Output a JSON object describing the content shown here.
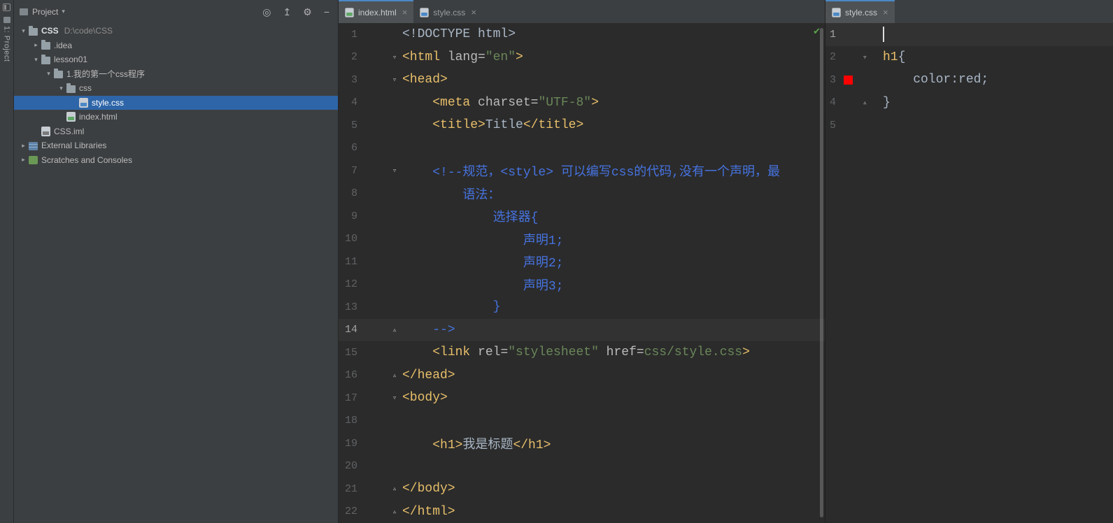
{
  "colors": {
    "selection_blue": "#2E65A8",
    "tab_accent": "#4A88C7",
    "comment_blue": "#4673E0",
    "tag_yellow": "#E8BF6A",
    "string_green": "#6A8759",
    "red_swatch": "#FF0000"
  },
  "tool_strip": {
    "button_label": "1: Project"
  },
  "project_panel": {
    "header": {
      "title": "Project",
      "icons": [
        {
          "name": "locate-file-icon",
          "glyph": "◎"
        },
        {
          "name": "collapse-all-icon",
          "glyph": "↥"
        },
        {
          "name": "settings-gear-icon",
          "glyph": "⚙"
        },
        {
          "name": "hide-panel-icon",
          "glyph": "−"
        }
      ]
    },
    "tree": [
      {
        "indent": 0,
        "chevron": "down",
        "icon": "folder",
        "label": "CSS",
        "bold": true,
        "suffix": "D:\\code\\CSS",
        "selected": false
      },
      {
        "indent": 1,
        "chevron": "right",
        "icon": "folder",
        "label": ".idea",
        "selected": false
      },
      {
        "indent": 1,
        "chevron": "down",
        "icon": "folder",
        "label": "lesson01",
        "selected": false
      },
      {
        "indent": 2,
        "chevron": "down",
        "icon": "folder",
        "label": "1.我的第一个css程序",
        "selected": false
      },
      {
        "indent": 3,
        "chevron": "down",
        "icon": "folder",
        "label": "css",
        "selected": false
      },
      {
        "indent": 4,
        "chevron": "none",
        "icon": "css-file",
        "label": "style.css",
        "selected": true
      },
      {
        "indent": 3,
        "chevron": "none",
        "icon": "html-file",
        "label": "index.html",
        "selected": false
      },
      {
        "indent": 1,
        "chevron": "none",
        "icon": "iml-file",
        "label": "CSS.iml",
        "selected": false
      },
      {
        "indent": 0,
        "chevron": "right",
        "icon": "library",
        "label": "External Libraries",
        "selected": false
      },
      {
        "indent": 0,
        "chevron": "right",
        "icon": "scratches",
        "label": "Scratches and Consoles",
        "selected": false
      }
    ]
  },
  "left_editor": {
    "tabs": [
      {
        "label": "index.html",
        "icon": "html-file",
        "active": true
      },
      {
        "label": "style.css",
        "icon": "css-file",
        "active": false
      }
    ],
    "inspection_glyph": "✔",
    "current_line": 14,
    "lines": [
      {
        "n": 1,
        "fold": "",
        "segs": [
          [
            "<!DOCTYPE html>",
            "plain"
          ]
        ]
      },
      {
        "n": 2,
        "fold": "start",
        "segs": [
          [
            "<html",
            "tag"
          ],
          [
            " lang=",
            "attr"
          ],
          [
            "\"en\"",
            "string"
          ],
          [
            ">",
            "tag"
          ]
        ]
      },
      {
        "n": 3,
        "fold": "start",
        "segs": [
          [
            "<head>",
            "tag"
          ]
        ]
      },
      {
        "n": 4,
        "fold": "",
        "segs": [
          [
            "    ",
            "plain"
          ],
          [
            "<meta",
            "tag"
          ],
          [
            " charset=",
            "attr"
          ],
          [
            "\"UTF-8\"",
            "string"
          ],
          [
            ">",
            "tag"
          ]
        ]
      },
      {
        "n": 5,
        "fold": "",
        "segs": [
          [
            "    ",
            "plain"
          ],
          [
            "<title>",
            "tag"
          ],
          [
            "Title",
            "plain"
          ],
          [
            "</title>",
            "tag"
          ]
        ]
      },
      {
        "n": 6,
        "fold": "",
        "segs": []
      },
      {
        "n": 7,
        "fold": "start",
        "segs": [
          [
            "    ",
            "plain"
          ],
          [
            "<!--规范，<style> 可以编写css的代码,没有一个声明，最",
            "comment"
          ]
        ]
      },
      {
        "n": 8,
        "fold": "",
        "segs": [
          [
            "        语法：",
            "comment"
          ]
        ]
      },
      {
        "n": 9,
        "fold": "",
        "segs": [
          [
            "            选择器{",
            "comment"
          ]
        ]
      },
      {
        "n": 10,
        "fold": "",
        "segs": [
          [
            "                声明1;",
            "comment"
          ]
        ]
      },
      {
        "n": 11,
        "fold": "",
        "segs": [
          [
            "                声明2;",
            "comment"
          ]
        ]
      },
      {
        "n": 12,
        "fold": "",
        "segs": [
          [
            "                声明3;",
            "comment"
          ]
        ]
      },
      {
        "n": 13,
        "fold": "",
        "segs": [
          [
            "            }",
            "comment"
          ]
        ]
      },
      {
        "n": 14,
        "fold": "end",
        "segs": [
          [
            "    -->",
            "comment"
          ]
        ]
      },
      {
        "n": 15,
        "fold": "",
        "segs": [
          [
            "    ",
            "plain"
          ],
          [
            "<link",
            "tag"
          ],
          [
            " rel=",
            "attr"
          ],
          [
            "\"stylesheet\"",
            "string"
          ],
          [
            " href=",
            "attr"
          ],
          [
            "css/style.css",
            "string"
          ],
          [
            ">",
            "tag"
          ]
        ]
      },
      {
        "n": 16,
        "fold": "end",
        "segs": [
          [
            "</head>",
            "tag"
          ]
        ]
      },
      {
        "n": 17,
        "fold": "start",
        "segs": [
          [
            "<body>",
            "tag"
          ]
        ]
      },
      {
        "n": 18,
        "fold": "",
        "segs": []
      },
      {
        "n": 19,
        "fold": "",
        "segs": [
          [
            "    ",
            "plain"
          ],
          [
            "<h1>",
            "tag"
          ],
          [
            "我是标题",
            "plain"
          ],
          [
            "</h1>",
            "tag"
          ]
        ]
      },
      {
        "n": 20,
        "fold": "",
        "segs": []
      },
      {
        "n": 21,
        "fold": "end",
        "segs": [
          [
            "</body>",
            "tag"
          ]
        ]
      },
      {
        "n": 22,
        "fold": "end",
        "segs": [
          [
            "</html>",
            "tag"
          ]
        ]
      }
    ]
  },
  "right_editor": {
    "tabs": [
      {
        "label": "style.css",
        "icon": "css-file",
        "active": true
      }
    ],
    "current_line": 1,
    "lines": [
      {
        "n": 1,
        "fold": "",
        "caret": true,
        "segs": []
      },
      {
        "n": 2,
        "fold": "start",
        "segs": [
          [
            "h1",
            "tag"
          ],
          [
            "{",
            "plain"
          ]
        ]
      },
      {
        "n": 3,
        "fold": "",
        "gutter_swatch": "#FF0000",
        "segs": [
          [
            "    color:red;",
            "plain"
          ]
        ]
      },
      {
        "n": 4,
        "fold": "end",
        "segs": [
          [
            "}",
            "plain"
          ]
        ]
      },
      {
        "n": 5,
        "fold": "",
        "segs": []
      }
    ]
  }
}
